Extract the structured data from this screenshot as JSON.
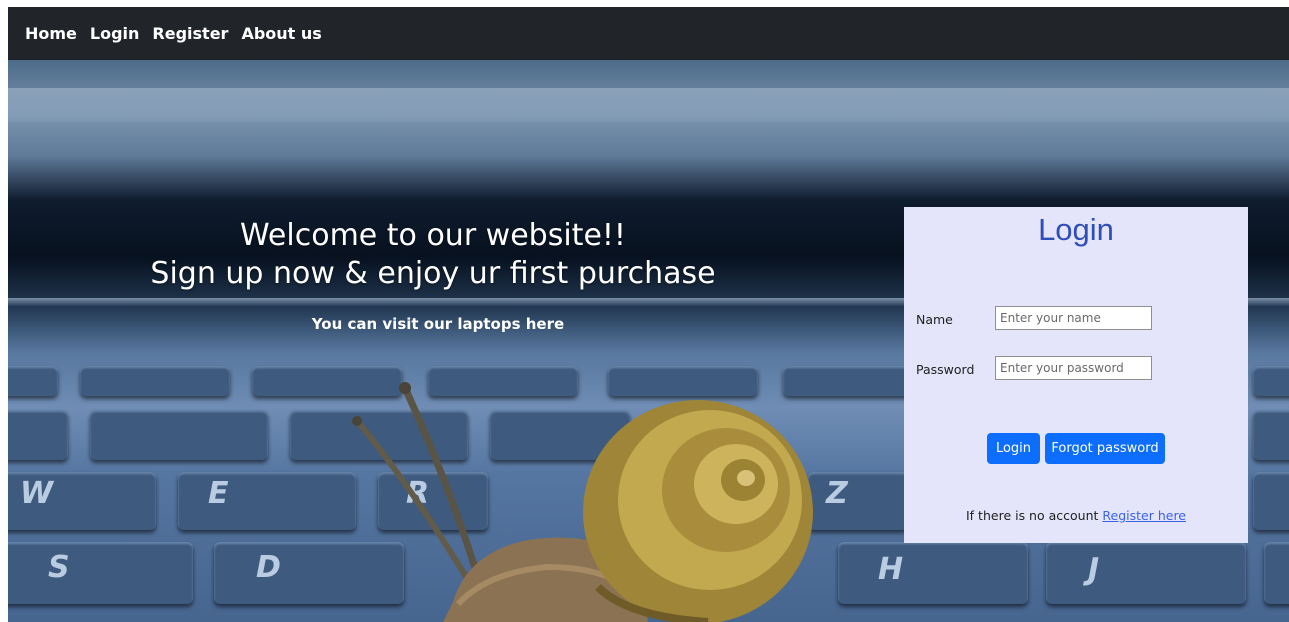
{
  "nav": {
    "items": [
      {
        "label": "Home"
      },
      {
        "label": "Login"
      },
      {
        "label": "Register"
      },
      {
        "label": "About us"
      }
    ]
  },
  "hero": {
    "headline_line1": "Welcome to our website!!",
    "headline_line2": "Sign up now & enjoy ur first purchase",
    "visit_link": "You can visit our laptops here",
    "keyboard_letters": [
      "W",
      "E",
      "R",
      "Z",
      "S",
      "D",
      "H",
      "J"
    ]
  },
  "login": {
    "title": "Login",
    "name_label": "Name",
    "name_placeholder": "Enter your name",
    "password_label": "Password",
    "password_placeholder": "Enter your password",
    "login_button": "Login",
    "forgot_button": "Forgot password",
    "no_account_text": "If there is no account",
    "register_link": "Register here"
  },
  "colors": {
    "navbar_bg": "#212529",
    "card_bg": "#e4e4fa",
    "title_color": "#2f4fb8",
    "button_bg": "#0d6efd",
    "link_color": "#3b63e6"
  }
}
